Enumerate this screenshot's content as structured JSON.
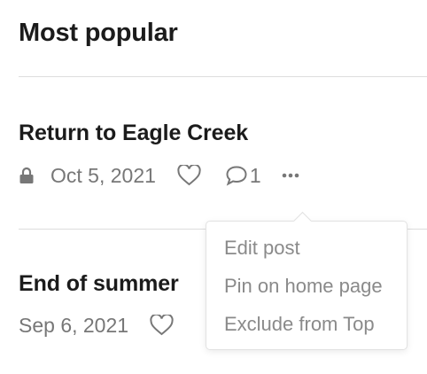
{
  "section": {
    "title": "Most popular"
  },
  "posts": [
    {
      "title": "Return to Eagle Creek",
      "date": "Oct 5, 2021",
      "locked": true,
      "comment_count": "1"
    },
    {
      "title": "End of summer",
      "date": "Sep 6, 2021",
      "locked": false
    }
  ],
  "context_menu": {
    "items": [
      {
        "label": "Edit post"
      },
      {
        "label": "Pin on home page"
      },
      {
        "label": "Exclude from Top"
      }
    ]
  },
  "colors": {
    "title": "#1b1b1b",
    "meta": "#777777",
    "menu_text": "#8a8a8a",
    "divider": "#dddddd"
  }
}
